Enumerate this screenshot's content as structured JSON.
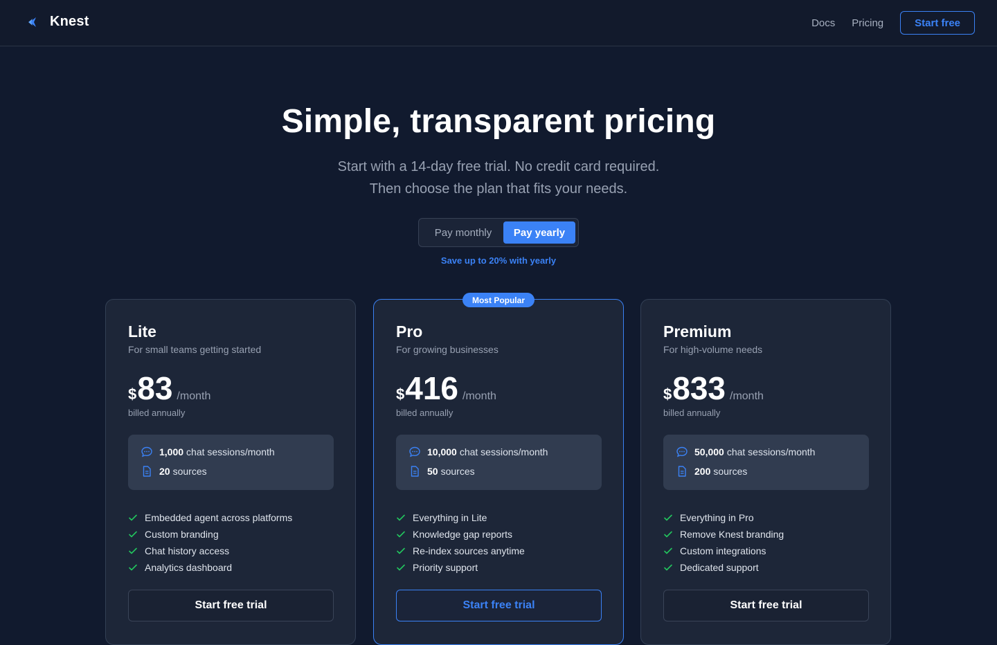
{
  "header": {
    "brand": "Knest",
    "nav": {
      "docs": "Docs",
      "pricing": "Pricing",
      "cta": "Start free"
    }
  },
  "hero": {
    "title": "Simple, transparent pricing",
    "subtitle_line1": "Start with a 14-day free trial. No credit card required.",
    "subtitle_line2": "Then choose the plan that fits your needs."
  },
  "billing": {
    "monthly": "Pay monthly",
    "yearly": "Pay yearly",
    "selected": "yearly",
    "note": "Save up to 20% with yearly"
  },
  "plans": [
    {
      "name": "Lite",
      "description": "For small teams getting started",
      "currency": "$",
      "price": "83",
      "period": "/month",
      "billing_note": "billed annually",
      "sessions_count": "1,000",
      "sessions_label": "chat sessions/month",
      "sources_count": "20",
      "sources_label": "sources",
      "features": [
        "Embedded agent across platforms",
        "Custom branding",
        "Chat history access",
        "Analytics dashboard"
      ],
      "cta": "Start free trial"
    },
    {
      "name": "Pro",
      "badge": "Most Popular",
      "description": "For growing businesses",
      "currency": "$",
      "price": "416",
      "period": "/month",
      "billing_note": "billed annually",
      "sessions_count": "10,000",
      "sessions_label": "chat sessions/month",
      "sources_count": "50",
      "sources_label": "sources",
      "features": [
        "Everything in Lite",
        "Knowledge gap reports",
        "Re-index sources anytime",
        "Priority support"
      ],
      "cta": "Start free trial"
    },
    {
      "name": "Premium",
      "description": "For high-volume needs",
      "currency": "$",
      "price": "833",
      "period": "/month",
      "billing_note": "billed annually",
      "sessions_count": "50,000",
      "sessions_label": "chat sessions/month",
      "sources_count": "200",
      "sources_label": "sources",
      "features": [
        "Everything in Pro",
        "Remove Knest branding",
        "Custom integrations",
        "Dedicated support"
      ],
      "cta": "Start free trial"
    }
  ],
  "icons": {
    "logo": "knest-logo-icon",
    "sessions": "chat-bubble-icon",
    "sources": "document-icon",
    "feature": "check-icon"
  },
  "colors": {
    "accent": "#3b82f6",
    "background": "#111a2e",
    "card": "#1d2638",
    "check": "#22c55e"
  }
}
